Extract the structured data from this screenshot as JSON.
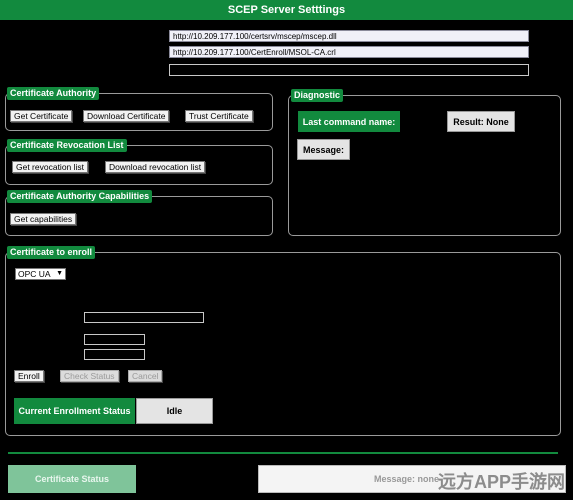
{
  "window": {
    "title": "SCEP Server Setttings"
  },
  "urls": {
    "scep_url": "http://10.209.177.100/certsrv/mscep/mscep.dll",
    "crl_url": "http://10.209.177.100/CertEnroll/MSOL-CA.crl",
    "extra_url": ""
  },
  "certificate_authority": {
    "label": "Certificate Authority",
    "get_certificate": "Get Certificate",
    "download_certificate": "Download Certificate",
    "trust_certificate": "Trust Certificate"
  },
  "crl": {
    "label": "Certificate Revocation List",
    "get_list": "Get revocation list",
    "download_list": "Download revocation list"
  },
  "capabilities": {
    "label": "Certificate Authority Capabilities",
    "get_capabilities": "Get capabilities"
  },
  "diagnostic": {
    "label": "Diagnostic",
    "last_command_label": "Last command name:",
    "result_value": "Result: None",
    "message_label": "Message:"
  },
  "enroll": {
    "label": "Certificate to enroll",
    "selected_type": "OPC UA",
    "enroll_button": "Enroll",
    "check_status_button": "Check Status",
    "cancel_button": "Cancel",
    "status_label": "Current Enrollment Status",
    "status_value": "Idle"
  },
  "footer": {
    "certificate_status_tab": "Certificate Status",
    "message_placeholder": "Message: none"
  },
  "watermark": {
    "text": "远方APP手游网"
  },
  "colors": {
    "accent": "#128a3e",
    "background": "#000000"
  }
}
